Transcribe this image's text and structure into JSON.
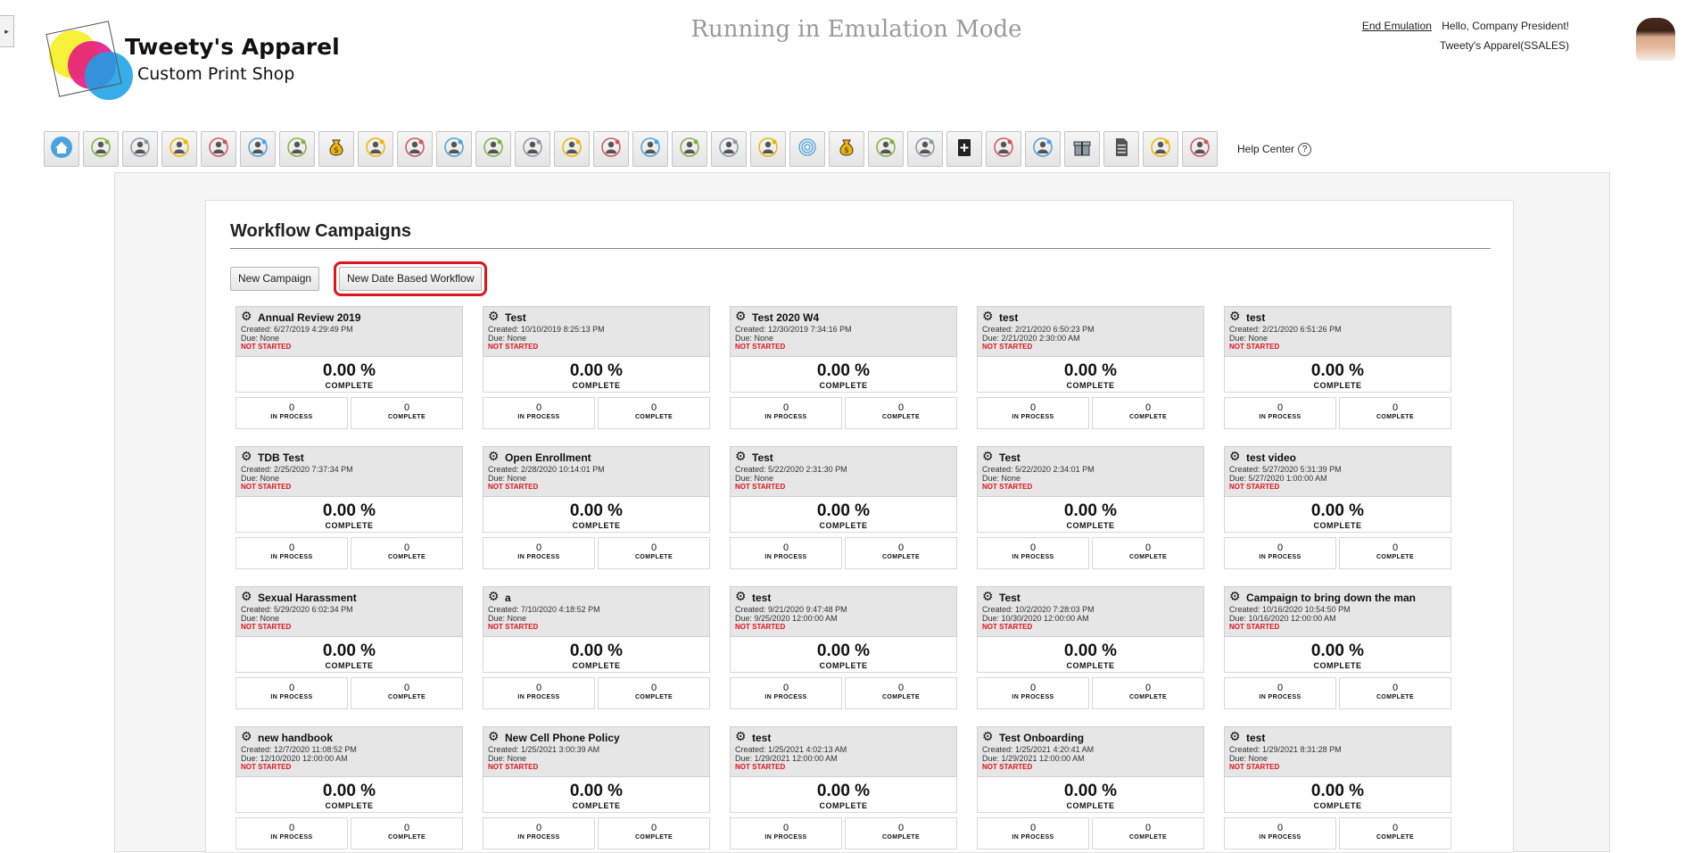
{
  "app": {
    "company_name": "Tweety's Apparel",
    "company_tagline": "Custom Print Shop",
    "emulation_banner": "Running in Emulation Mode",
    "end_emulation": "End Emulation",
    "greeting": "Hello, Company President!",
    "account": "Tweety's Apparel(SSALES)",
    "side_tab": "▸"
  },
  "toolbar": {
    "icons": [
      "home-icon",
      "target-person-icon",
      "settings-people-icon",
      "presentation-icon",
      "group-icon",
      "org-chart-icon",
      "document-icon",
      "money-bag-icon",
      "search-person-icon",
      "target-icon",
      "target-arrows-icon",
      "growth-chart-icon",
      "target-icon",
      "transfer-person-icon",
      "signpost-person-icon",
      "shield-person-icon",
      "person-badge-icon",
      "transfer-person-icon",
      "person-remove-icon",
      "fingerprint-icon",
      "money-bag-icon",
      "signpost-person-icon",
      "team-chart-icon",
      "clipboard-plus-icon",
      "shield-person-icon",
      "person-search-icon",
      "gift-icon",
      "file-icon",
      "team-board-icon",
      "person-award-icon"
    ],
    "help_center": "Help Center",
    "help_q": "?"
  },
  "page": {
    "title": "Workflow Campaigns",
    "new_campaign": "New Campaign",
    "new_date_workflow": "New Date Based Workflow"
  },
  "labels": {
    "complete": "COMPLETE",
    "in_process": "IN PROCESS",
    "gear": "⚙"
  },
  "accent": {
    "status_red": "#e0141e",
    "highlight": "#e0141e"
  },
  "campaigns": [
    {
      "title": "Annual Review 2019",
      "created": "Created: 6/27/2019 4:29:49 PM",
      "due": "Due: None",
      "status": "NOT STARTED",
      "percent": "0.00 %",
      "in_process": "0",
      "complete": "0"
    },
    {
      "title": "Test",
      "created": "Created: 10/10/2019 8:25:13 PM",
      "due": "Due: None",
      "status": "NOT STARTED",
      "percent": "0.00 %",
      "in_process": "0",
      "complete": "0"
    },
    {
      "title": "Test 2020 W4",
      "created": "Created: 12/30/2019 7:34:16 PM",
      "due": "Due: None",
      "status": "NOT STARTED",
      "percent": "0.00 %",
      "in_process": "0",
      "complete": "0"
    },
    {
      "title": "test",
      "created": "Created: 2/21/2020 6:50:23 PM",
      "due": "Due: 2/21/2020 2:30:00 AM",
      "status": "NOT STARTED",
      "percent": "0.00 %",
      "in_process": "0",
      "complete": "0"
    },
    {
      "title": "test",
      "created": "Created: 2/21/2020 6:51:26 PM",
      "due": "Due: None",
      "status": "NOT STARTED",
      "percent": "0.00 %",
      "in_process": "0",
      "complete": "0"
    },
    {
      "title": "TDB Test",
      "created": "Created: 2/25/2020 7:37:34 PM",
      "due": "Due: None",
      "status": "NOT STARTED",
      "percent": "0.00 %",
      "in_process": "0",
      "complete": "0"
    },
    {
      "title": "Open Enrollment",
      "created": "Created: 2/28/2020 10:14:01 PM",
      "due": "Due: None",
      "status": "NOT STARTED",
      "percent": "0.00 %",
      "in_process": "0",
      "complete": "0"
    },
    {
      "title": "Test",
      "created": "Created: 5/22/2020 2:31:30 PM",
      "due": "Due: None",
      "status": "NOT STARTED",
      "percent": "0.00 %",
      "in_process": "0",
      "complete": "0"
    },
    {
      "title": "Test",
      "created": "Created: 5/22/2020 2:34:01 PM",
      "due": "Due: None",
      "status": "NOT STARTED",
      "percent": "0.00 %",
      "in_process": "0",
      "complete": "0"
    },
    {
      "title": "test video",
      "created": "Created: 5/27/2020 5:31:39 PM",
      "due": "Due: 5/27/2020 1:00:00 AM",
      "status": "NOT STARTED",
      "percent": "0.00 %",
      "in_process": "0",
      "complete": "0"
    },
    {
      "title": "Sexual Harassment",
      "created": "Created: 5/29/2020 6:02:34 PM",
      "due": "Due: None",
      "status": "NOT STARTED",
      "percent": "0.00 %",
      "in_process": "0",
      "complete": "0"
    },
    {
      "title": "a",
      "created": "Created: 7/10/2020 4:18:52 PM",
      "due": "Due: None",
      "status": "NOT STARTED",
      "percent": "0.00 %",
      "in_process": "0",
      "complete": "0"
    },
    {
      "title": "test",
      "created": "Created: 9/21/2020 9:47:48 PM",
      "due": "Due: 9/25/2020 12:00:00 AM",
      "status": "NOT STARTED",
      "percent": "0.00 %",
      "in_process": "0",
      "complete": "0"
    },
    {
      "title": "Test",
      "created": "Created: 10/2/2020 7:28:03 PM",
      "due": "Due: 10/30/2020 12:00:00 AM",
      "status": "NOT STARTED",
      "percent": "0.00 %",
      "in_process": "0",
      "complete": "0"
    },
    {
      "title": "Campaign to bring down the man",
      "created": "Created: 10/16/2020 10:54:50 PM",
      "due": "Due: 10/16/2020 12:00:00 AM",
      "status": "NOT STARTED",
      "percent": "0.00 %",
      "in_process": "0",
      "complete": "0"
    },
    {
      "title": "new handbook",
      "created": "Created: 12/7/2020 11:08:52 PM",
      "due": "Due: 12/10/2020 12:00:00 AM",
      "status": "NOT STARTED",
      "percent": "0.00 %",
      "in_process": "0",
      "complete": "0"
    },
    {
      "title": "New Cell Phone Policy",
      "created": "Created: 1/25/2021 3:00:39 AM",
      "due": "Due: None",
      "status": "NOT STARTED",
      "percent": "0.00 %",
      "in_process": "0",
      "complete": "0"
    },
    {
      "title": "test",
      "created": "Created: 1/25/2021 4:02:13 AM",
      "due": "Due: 1/29/2021 12:00:00 AM",
      "status": "NOT STARTED",
      "percent": "0.00 %",
      "in_process": "0",
      "complete": "0"
    },
    {
      "title": "Test Onboarding",
      "created": "Created: 1/25/2021 4:20:41 AM",
      "due": "Due: 1/29/2021 12:00:00 AM",
      "status": "NOT STARTED",
      "percent": "0.00 %",
      "in_process": "0",
      "complete": "0"
    },
    {
      "title": "test",
      "created": "Created: 1/29/2021 8:31:28 PM",
      "due": "Due: None",
      "status": "NOT STARTED",
      "percent": "0.00 %",
      "in_process": "0",
      "complete": "0"
    }
  ]
}
